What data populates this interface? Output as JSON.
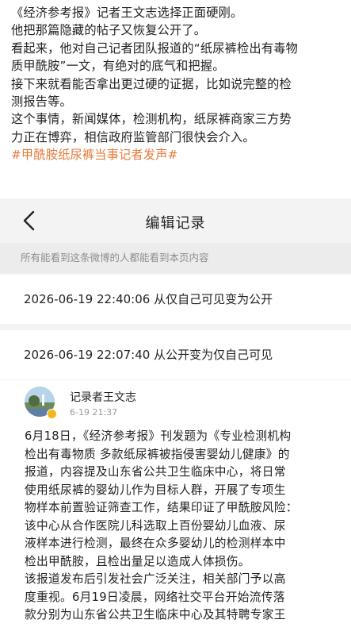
{
  "caption": {
    "lines": [
      "《经济参考报》记者王文志选择正面硬刚。",
      "他把那篇隐藏的帖子又恢复公开了。",
      "看起来，他对自己记者团队报道的“纸尿裤检出有毒物",
      "质甲酰胺”一文，有绝对的底气和把握。",
      "接下来就看能否拿出更过硬的证据，比如说完整的检",
      "测报告等。",
      "这个事情，新闻媒体，检测机构，纸尿裤商家三方势",
      "力正在博弈，相信政府监管部门很快会介入。"
    ],
    "hashtag": "#甲酰胺纸尿裤当事记者发声#"
  },
  "screenshot": {
    "nav": {
      "back_icon": "chevron-left-icon",
      "title": "编辑记录"
    },
    "notice": "所有能看到这条微博的人都能看到本页内容",
    "records": [
      "2026-06-19 22:40:06 从仅自己可见变为公开",
      "2026-06-19 22:07:40 从公开变为仅自己可见"
    ],
    "post": {
      "author": "记录者王文志",
      "time": "6-19 21:37",
      "verified_color": "#f2b51f",
      "body_lines": [
        "6月18日，《经济参考报》刊发题为《专业检测机构",
        "检出有毒物质 多款纸尿裤被指侵害婴幼儿健康》的",
        "报道，内容提及山东省公共卫生临床中心，将日常",
        "使用纸尿裤的婴幼儿作为目标人群，开展了专项生",
        "物样本前置验证筛查工作，结果印证了甲酰胺风险：",
        "该中心从合作医院儿科选取上百份婴幼儿血液、尿",
        "液样本进行检测，最终在众多婴幼儿的检测样本中",
        "检出甲酰胺，且检出量足以造成人体损伤。",
        "该报道发布后引发社会广泛关注，相关部门予以高",
        "度重视。6月19日凌晨，网络社交平台开始流传落",
        "款分别为山东省公共卫生临床中心及其特聘专家王"
      ]
    }
  },
  "colors": {
    "hashtag": "#e37b3b",
    "screenshot_bg": "#f3f3f3",
    "notice_bg": "#ececec"
  }
}
